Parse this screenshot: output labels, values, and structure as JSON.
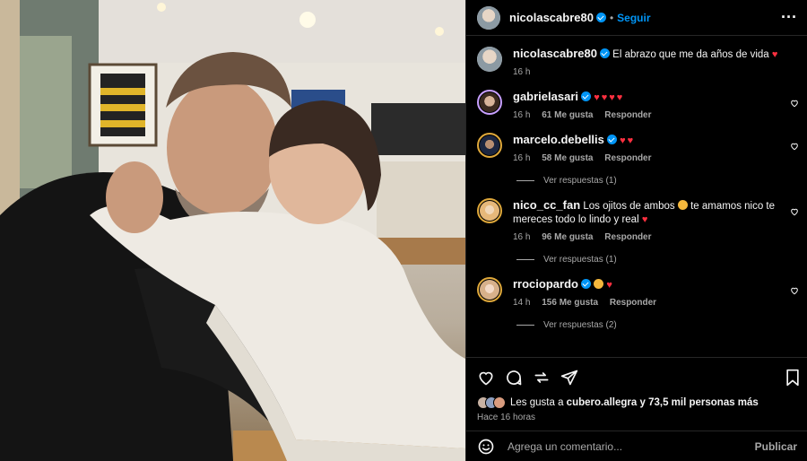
{
  "post": {
    "username": "nicolascabre80",
    "follow_label": "Seguir",
    "caption": "El abrazo que me da años de vida",
    "caption_time": "16 h"
  },
  "comments": [
    {
      "username": "gabrielasari",
      "text": "",
      "hearts": "♥♥♥♥",
      "time": "16 h",
      "likes": "61 Me gusta",
      "reply": "Responder",
      "replies": ""
    },
    {
      "username": "marcelo.debellis",
      "text": "",
      "hearts": "♥♥",
      "time": "16 h",
      "likes": "58 Me gusta",
      "reply": "Responder",
      "replies": "Ver respuestas (1)"
    },
    {
      "username": "nico_cc_fan",
      "text": "Los ojitos de ambos",
      "text2": "te amamos nico te mereces todo lo lindo y real",
      "hearts": "♥",
      "time": "16 h",
      "likes": "96 Me gusta",
      "reply": "Responder",
      "replies": "Ver respuestas (1)"
    },
    {
      "username": "rrociopardo",
      "text": "",
      "hearts": "♥",
      "time": "14 h",
      "likes": "156 Me gusta",
      "reply": "Responder",
      "replies": "Ver respuestas (2)"
    }
  ],
  "likes_bar": {
    "prefix": "Les gusta a",
    "user": "cubero.allegra",
    "suffix": "y 73,5 mil personas más",
    "ago": "Hace 16 horas"
  },
  "add_comment": {
    "placeholder": "Agrega un comentario...",
    "publish": "Publicar"
  },
  "colors": {
    "accent": "#0095f6",
    "heart": "#ff3040",
    "bg": "#000000"
  },
  "icons": [
    "heart-icon",
    "comment-icon",
    "share-icon",
    "send-icon",
    "bookmark-icon",
    "emoji-icon",
    "more-icon"
  ]
}
